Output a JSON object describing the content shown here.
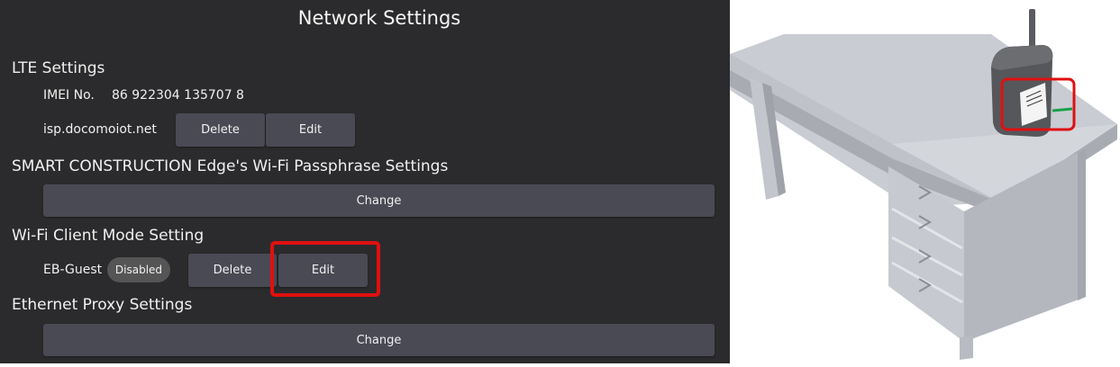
{
  "header": {
    "title": "Network Settings"
  },
  "lte": {
    "heading": "LTE Settings",
    "imei_label": "IMEI No.",
    "imei_value": "86 922304 135707 8",
    "apn_name": "isp.docomoiot.net",
    "delete_label": "Delete",
    "edit_label": "Edit"
  },
  "wifi_passphrase": {
    "heading": "SMART CONSTRUCTION Edge's Wi-Fi Passphrase Settings",
    "change_label": "Change"
  },
  "wifi_client": {
    "heading": "Wi-Fi Client Mode Setting",
    "ssid": "EB-Guest",
    "status_badge": "Disabled",
    "delete_label": "Delete",
    "edit_label": "Edit"
  },
  "ethernet_proxy": {
    "heading": "Ethernet Proxy Settings",
    "change_label": "Change"
  },
  "colors": {
    "panel_bg": "#2b2b2d",
    "button_bg": "#4a4a55",
    "highlight": "#e01010",
    "cable": "#1aa04a"
  }
}
